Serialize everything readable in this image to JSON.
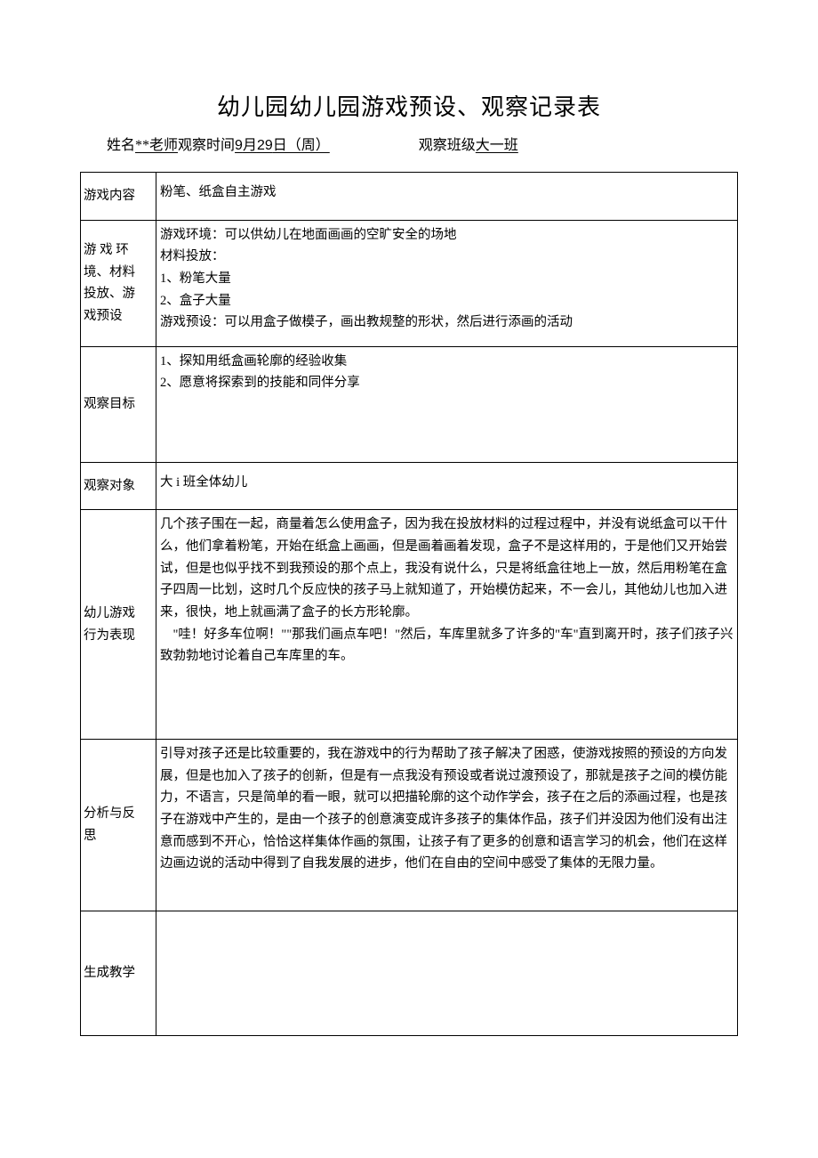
{
  "title": "幼儿园幼儿园游戏预设、观察记录表",
  "header": {
    "name_label": "姓名",
    "name_value": "**老师",
    "time_label": "观察时间",
    "time_value_prefix": "9",
    "time_value_mid": "月",
    "time_value_day": "29",
    "time_value_suffix": "日（周）",
    "class_label": "观察班级",
    "class_value": "大一班"
  },
  "rows": {
    "content": {
      "label": "游戏内容",
      "value": "粉笔、纸盒自主游戏"
    },
    "environment": {
      "label_l1": "游 戏 环",
      "label_l2": "境、材料",
      "label_l3": "投放、游",
      "label_l4": "戏预设",
      "lines": [
        "游戏环境：可以供幼儿在地面画画的空旷安全的场地",
        "材料投放：",
        "1、粉笔大量",
        "2、盒子大量",
        "游戏预设：可以用盒子做模子，画出教规整的形状，然后进行添画的活动"
      ]
    },
    "goal": {
      "label": "观察目标",
      "lines": [
        "1、探知用纸盒画轮廓的经验收集",
        "2、愿意将探索到的技能和同伴分享"
      ]
    },
    "subject": {
      "label": "观察对象",
      "value": "大 i 班全体幼儿"
    },
    "behavior": {
      "label_l1": "幼儿游戏",
      "label_l2": "行为表现",
      "text": "几个孩子围在一起，商量着怎么使用盒子，因为我在投放材料的过程过程中，并没有说纸盒可以干什么，他们拿着粉笔，开始在纸盒上画画，但是画着画着发现，盒子不是这样用的，于是他们又开始尝试，但是也似乎找不到我预设的那个点上，我没有说什么，只是将纸盒往地上一放，然后用粉笔在盒子四周一比划，这时几个反应快的孩子马上就知道了，开始模仿起来，不一会儿，其他幼儿也加入进来，很快，地上就画满了盒子的长方形轮廓。",
      "text2": "　\"哇！好多车位啊！\"\"那我们画点车吧！\"然后，车库里就多了许多的\"车\"直到离开时，孩子们孩子兴致勃勃地讨论着自己车库里的车。"
    },
    "analysis": {
      "label_l1": "分析与反",
      "label_l2": "思",
      "text": "引导对孩子还是比较重要的，我在游戏中的行为帮助了孩子解决了困惑，使游戏按照的预设的方向发展，但是也加入了孩子的创新，但是有一点我没有预设或者说过渡预设了，那就是孩子之间的模仿能力，不语言，只是简单的看一眼，就可以把描轮廓的这个动作学会，孩子在之后的添画过程，也是孩子在游戏中产生的，是由一个孩子的创意演变成许多孩子的集体作品，孩子们并没因为他们没有出注意而感到不开心，恰恰这样集体作画的氛围，让孩子有了更多的创意和语言学习的机会，他们在这样边画边说的活动中得到了自我发展的进步，他们在自由的空间中感受了集体的无限力量。"
    },
    "generate": {
      "label": "生成教学",
      "value": ""
    }
  }
}
